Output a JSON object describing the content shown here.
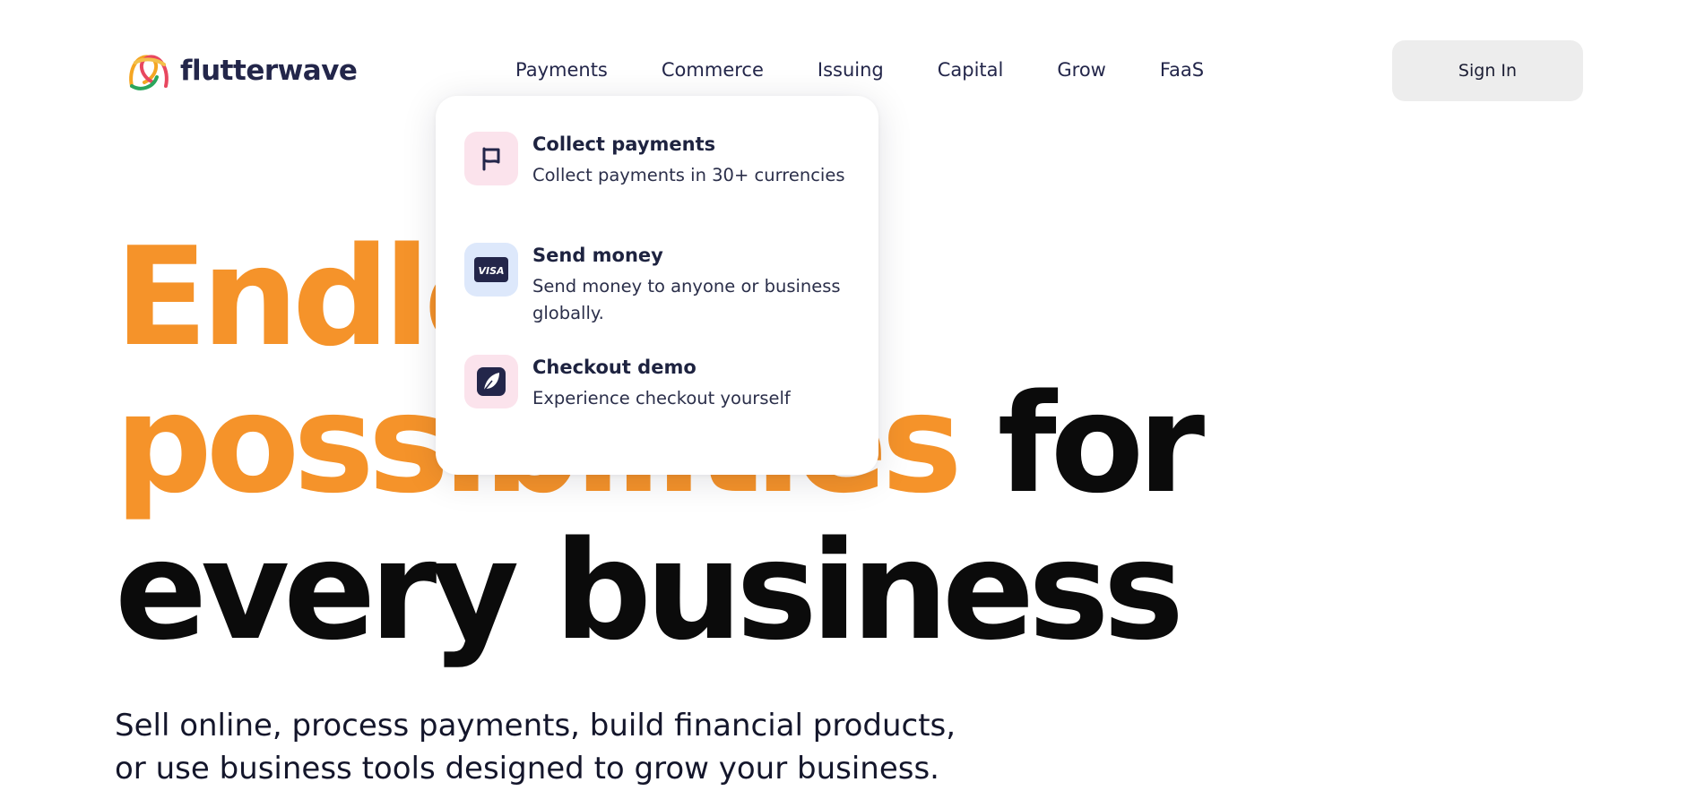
{
  "header": {
    "logo_text": "flutterwave",
    "nav": [
      {
        "label": "Payments"
      },
      {
        "label": "Commerce"
      },
      {
        "label": "Issuing"
      },
      {
        "label": "Capital"
      },
      {
        "label": "Grow"
      },
      {
        "label": "FaaS"
      }
    ],
    "sign_in_label": "Sign In"
  },
  "dropdown": {
    "items": [
      {
        "title": "Collect payments",
        "description": "Collect payments in 30+ currencies",
        "icon": "flag-icon"
      },
      {
        "title": "Send money",
        "description": "Send money to anyone or business globally.",
        "icon": "visa-card-icon"
      },
      {
        "title": "Checkout demo",
        "description": "Experience checkout yourself",
        "icon": "leaf-icon"
      }
    ]
  },
  "hero": {
    "line1": "Endless",
    "line2_accent": "possibilities",
    "line2_rest": " for",
    "line3": "every business"
  },
  "subtitle": "Sell online, process payments, build financial products, or use business tools designed to grow your business.",
  "colors": {
    "accent": "#f5932a",
    "text_dark": "#23264a",
    "signin_bg": "#ededed"
  }
}
